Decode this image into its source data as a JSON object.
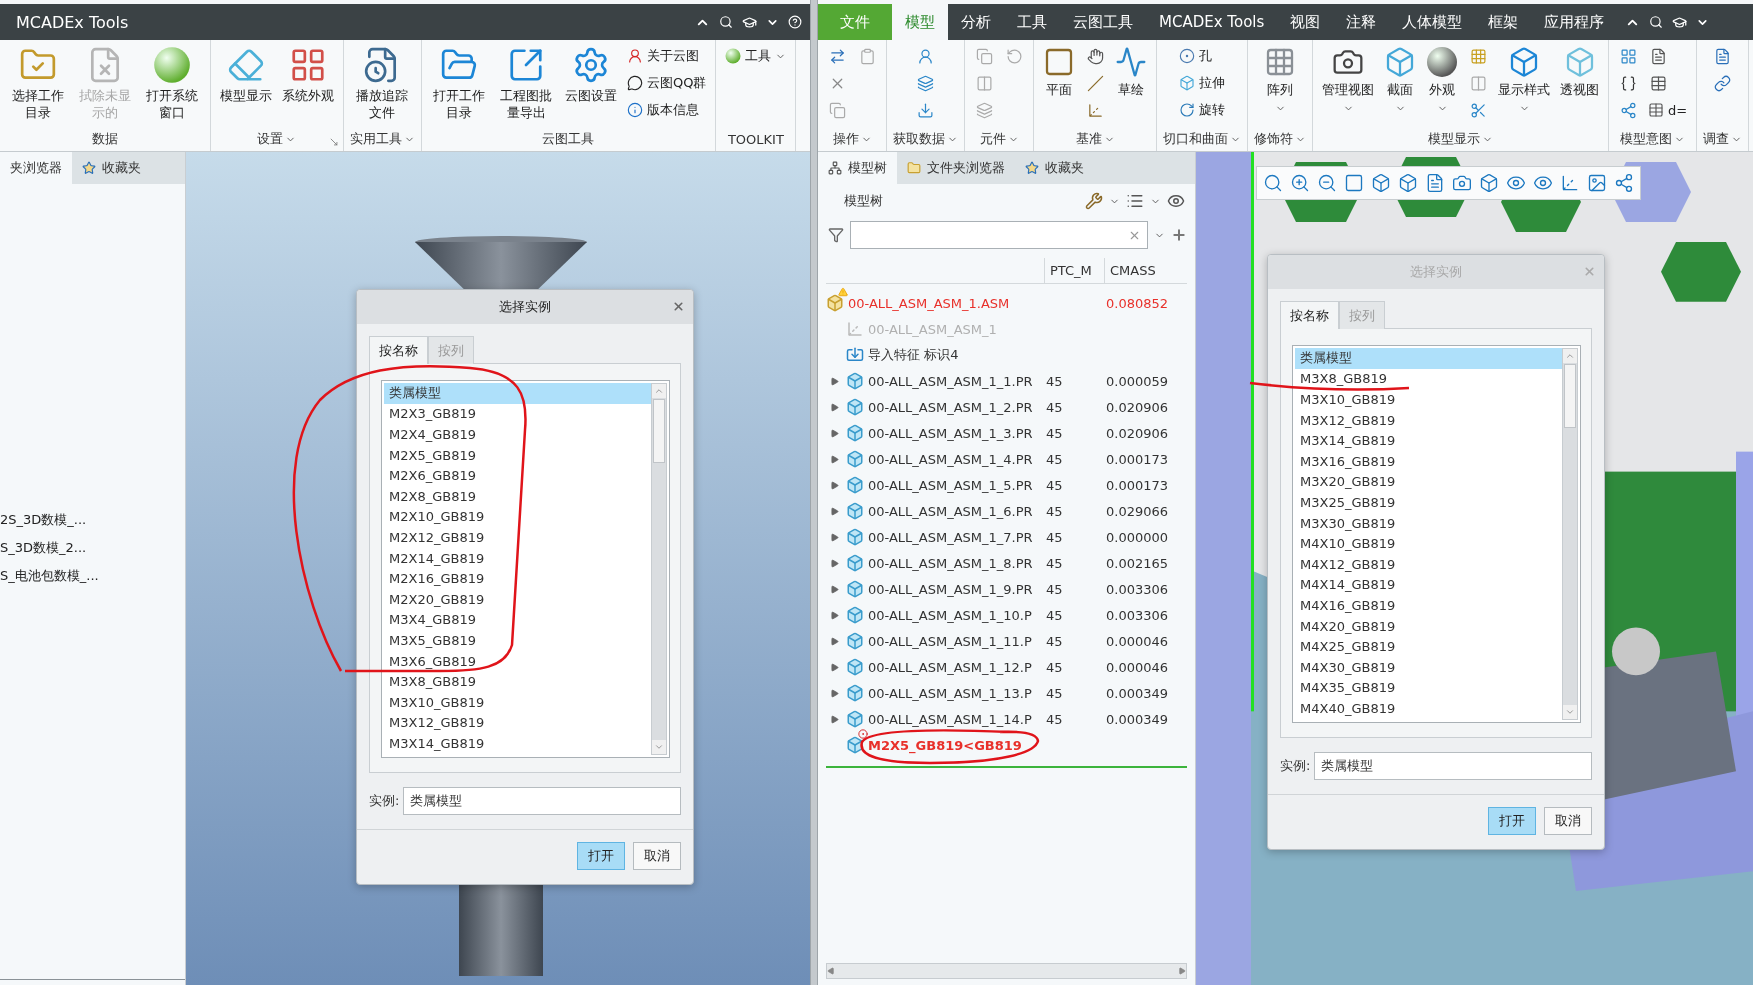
{
  "left_window": {
    "title": "MCADEx Tools",
    "ribbon_groups": [
      {
        "label": "数据",
        "dropdown": false,
        "items": [
          {
            "kind": "large",
            "label": "选择工作目录",
            "disabled": false
          },
          {
            "kind": "large",
            "label": "拭除未显示的",
            "disabled": true
          },
          {
            "kind": "large",
            "label": "打开系统窗口",
            "disabled": false
          }
        ]
      },
      {
        "label": "设置",
        "dropdown": true,
        "launcher": true,
        "items": [
          {
            "kind": "large",
            "label": "模型显示",
            "disabled": false
          },
          {
            "kind": "large",
            "label": "系统外观",
            "disabled": false
          }
        ]
      },
      {
        "label": "实用工具",
        "dropdown": true,
        "items": [
          {
            "kind": "large",
            "label": "播放追踪文件",
            "disabled": false
          }
        ]
      },
      {
        "label": "云图工具",
        "dropdown": false,
        "items": [
          {
            "kind": "large",
            "label": "打开工作目录",
            "disabled": false
          },
          {
            "kind": "large",
            "label": "工程图批量导出",
            "disabled": false
          },
          {
            "kind": "large",
            "label": "云图设置",
            "disabled": false
          },
          {
            "kind": "small",
            "label": "关于云图",
            "disabled": false
          },
          {
            "kind": "small",
            "label": "云图QQ群",
            "disabled": false
          },
          {
            "kind": "small",
            "label": "版本信息",
            "disabled": false
          }
        ]
      },
      {
        "label": "TOOLKIT",
        "dropdown": false,
        "items": [
          {
            "kind": "small",
            "label": "工具",
            "disabled": false,
            "dropdown": true
          }
        ]
      }
    ],
    "side_tabs": [
      {
        "label": "夹浏览器",
        "selected": true
      },
      {
        "label": "收藏夹",
        "selected": false
      }
    ],
    "side_items": [
      "2S_3D数模_...",
      "S_3D数模_2...",
      "S_电池包数模_..."
    ],
    "dialog": {
      "title": "选择实例",
      "active": true,
      "tabs": [
        {
          "label": "按名称",
          "selected": true
        },
        {
          "label": "按列",
          "selected": false
        }
      ],
      "list": [
        {
          "label": "类属模型",
          "selected": true
        },
        {
          "label": "M2X3_GB819",
          "selected": false
        },
        {
          "label": "M2X4_GB819",
          "selected": false
        },
        {
          "label": "M2X5_GB819",
          "selected": false
        },
        {
          "label": "M2X6_GB819",
          "selected": false
        },
        {
          "label": "M2X8_GB819",
          "selected": false
        },
        {
          "label": "M2X10_GB819",
          "selected": false
        },
        {
          "label": "M2X12_GB819",
          "selected": false
        },
        {
          "label": "M2X14_GB819",
          "selected": false
        },
        {
          "label": "M2X16_GB819",
          "selected": false
        },
        {
          "label": "M2X20_GB819",
          "selected": false
        },
        {
          "label": "M3X4_GB819",
          "selected": false
        },
        {
          "label": "M3X5_GB819",
          "selected": false
        },
        {
          "label": "M3X6_GB819",
          "selected": false
        },
        {
          "label": "M3X8_GB819",
          "selected": false
        },
        {
          "label": "M3X10_GB819",
          "selected": false
        },
        {
          "label": "M3X12_GB819",
          "selected": false
        },
        {
          "label": "M3X14_GB819",
          "selected": false
        }
      ],
      "instance_label": "实例:",
      "instance_value": "类属模型",
      "buttons": [
        {
          "label": "打开",
          "primary": true
        },
        {
          "label": "取消",
          "primary": false
        }
      ]
    }
  },
  "right_window": {
    "tabs": [
      {
        "label": "文件",
        "kind": "file",
        "selected": false
      },
      {
        "label": "模型",
        "kind": "tab",
        "selected": true
      },
      {
        "label": "分析",
        "kind": "tab",
        "selected": false
      },
      {
        "label": "工具",
        "kind": "tab",
        "selected": false
      },
      {
        "label": "云图工具",
        "kind": "tab",
        "selected": false
      },
      {
        "label": "MCADEx Tools",
        "kind": "tab",
        "selected": false
      },
      {
        "label": "视图",
        "kind": "tab",
        "selected": false
      },
      {
        "label": "注释",
        "kind": "tab",
        "selected": false
      },
      {
        "label": "人体模型",
        "kind": "tab",
        "selected": false
      },
      {
        "label": "框架",
        "kind": "tab",
        "selected": false
      },
      {
        "label": "应用程序",
        "kind": "tab",
        "selected": false
      }
    ],
    "ribbon_groups": [
      {
        "label": "操作",
        "dropdown": true,
        "items": [
          {
            "kind": "icon"
          },
          {
            "kind": "icon"
          },
          {
            "kind": "icon"
          },
          {
            "kind": "icon"
          }
        ]
      },
      {
        "label": "获取数据",
        "dropdown": true,
        "items": [
          {
            "kind": "icon"
          },
          {
            "kind": "icon"
          },
          {
            "kind": "icon"
          }
        ]
      },
      {
        "label": "元件",
        "dropdown": true,
        "items": [
          {
            "kind": "icon"
          },
          {
            "kind": "icon"
          },
          {
            "kind": "icon"
          },
          {
            "kind": "icon"
          }
        ]
      },
      {
        "label": "基准",
        "dropdown": true,
        "items": [
          {
            "kind": "large",
            "label": "平面",
            "dropdown": false
          },
          {
            "kind": "icon"
          },
          {
            "kind": "icon"
          },
          {
            "kind": "icon"
          },
          {
            "kind": "large",
            "label": "草绘",
            "dropdown": false
          }
        ]
      },
      {
        "label": "切口和曲面",
        "dropdown": true,
        "items": [
          {
            "kind": "small",
            "label": "孔"
          },
          {
            "kind": "small",
            "label": "拉伸"
          },
          {
            "kind": "small",
            "label": "旋转"
          }
        ]
      },
      {
        "label": "修饰符",
        "dropdown": true,
        "items": [
          {
            "kind": "large",
            "label": "阵列",
            "dropdown": true
          }
        ]
      },
      {
        "label": "模型显示",
        "dropdown": true,
        "items": [
          {
            "kind": "large",
            "label": "管理视图",
            "dropdown": true
          },
          {
            "kind": "large",
            "label": "截面",
            "dropdown": true
          },
          {
            "kind": "large",
            "label": "外观",
            "dropdown": true
          },
          {
            "kind": "icon"
          },
          {
            "kind": "icon"
          },
          {
            "kind": "icon"
          },
          {
            "kind": "large",
            "label": "显示样式",
            "dropdown": true
          },
          {
            "kind": "large",
            "label": "透视图",
            "dropdown": false
          }
        ]
      },
      {
        "label": "模型意图",
        "dropdown": true,
        "items": [
          {
            "kind": "icon"
          },
          {
            "kind": "icon"
          },
          {
            "kind": "icon"
          },
          {
            "kind": "icon"
          },
          {
            "kind": "icon"
          },
          {
            "kind": "small",
            "label": "d="
          }
        ]
      },
      {
        "label": "调查",
        "dropdown": true,
        "items": [
          {
            "kind": "icon"
          },
          {
            "kind": "icon"
          }
        ]
      }
    ],
    "model_tree": {
      "tabs": [
        {
          "label": "模型树",
          "selected": true
        },
        {
          "label": "文件夹浏览器",
          "selected": false
        },
        {
          "label": "收藏夹",
          "selected": false
        }
      ],
      "header": "模型树",
      "columns": [
        "PTC_M",
        "CMASS"
      ],
      "root": {
        "name": "00-ALL_ASM_ASM_1.ASM",
        "kind": "assembly",
        "warning": true,
        "mass": "0.080852",
        "children": [
          {
            "name": "00-ALL_ASM_ASM_1",
            "kind": "csys",
            "disabled": true,
            "error": false
          },
          {
            "name": "导入特征 标识4",
            "kind": "import",
            "disabled": false,
            "error": false
          },
          {
            "name": "00-ALL_ASM_ASM_1_1.PR",
            "kind": "part",
            "disabled": false,
            "error": false,
            "expanded": false,
            "material": "45",
            "mass": "0.000059"
          },
          {
            "name": "00-ALL_ASM_ASM_1_2.PR",
            "kind": "part",
            "disabled": false,
            "error": false,
            "expanded": false,
            "material": "45",
            "mass": "0.020906"
          },
          {
            "name": "00-ALL_ASM_ASM_1_3.PR",
            "kind": "part",
            "disabled": false,
            "error": false,
            "expanded": false,
            "material": "45",
            "mass": "0.020906"
          },
          {
            "name": "00-ALL_ASM_ASM_1_4.PR",
            "kind": "part",
            "disabled": false,
            "error": false,
            "expanded": false,
            "material": "45",
            "mass": "0.000173"
          },
          {
            "name": "00-ALL_ASM_ASM_1_5.PR",
            "kind": "part",
            "disabled": false,
            "error": false,
            "expanded": false,
            "material": "45",
            "mass": "0.000173"
          },
          {
            "name": "00-ALL_ASM_ASM_1_6.PR",
            "kind": "part",
            "disabled": false,
            "error": false,
            "expanded": false,
            "material": "45",
            "mass": "0.029066"
          },
          {
            "name": "00-ALL_ASM_ASM_1_7.PR",
            "kind": "part",
            "disabled": false,
            "error": false,
            "expanded": false,
            "material": "45",
            "mass": "0.000000"
          },
          {
            "name": "00-ALL_ASM_ASM_1_8.PR",
            "kind": "part",
            "disabled": false,
            "error": false,
            "expanded": false,
            "material": "45",
            "mass": "0.002165"
          },
          {
            "name": "00-ALL_ASM_ASM_1_9.PR",
            "kind": "part",
            "disabled": false,
            "error": false,
            "expanded": false,
            "material": "45",
            "mass": "0.003306"
          },
          {
            "name": "00-ALL_ASM_ASM_1_10.P",
            "kind": "part",
            "disabled": false,
            "error": false,
            "expanded": false,
            "material": "45",
            "mass": "0.003306"
          },
          {
            "name": "00-ALL_ASM_ASM_1_11.P",
            "kind": "part",
            "disabled": false,
            "error": false,
            "expanded": false,
            "material": "45",
            "mass": "0.000046"
          },
          {
            "name": "00-ALL_ASM_ASM_1_12.P",
            "kind": "part",
            "disabled": false,
            "error": false,
            "expanded": false,
            "material": "45",
            "mass": "0.000046"
          },
          {
            "name": "00-ALL_ASM_ASM_1_13.P",
            "kind": "part",
            "disabled": false,
            "error": false,
            "expanded": false,
            "material": "45",
            "mass": "0.000349"
          },
          {
            "name": "00-ALL_ASM_ASM_1_14.P",
            "kind": "part",
            "disabled": false,
            "error": false,
            "expanded": false,
            "material": "45",
            "mass": "0.000349"
          },
          {
            "name": "M2X5_GB819<GB819",
            "kind": "part",
            "disabled": false,
            "error": true
          }
        ]
      }
    },
    "dialog": {
      "title": "选择实例",
      "active": false,
      "tabs": [
        {
          "label": "按名称",
          "selected": true
        },
        {
          "label": "按列",
          "selected": false
        }
      ],
      "list": [
        {
          "label": "类属模型",
          "selected": true
        },
        {
          "label": "M3X8_GB819",
          "selected": false
        },
        {
          "label": "M3X10_GB819",
          "selected": false
        },
        {
          "label": "M3X12_GB819",
          "selected": false
        },
        {
          "label": "M3X14_GB819",
          "selected": false
        },
        {
          "label": "M3X16_GB819",
          "selected": false
        },
        {
          "label": "M3X20_GB819",
          "selected": false
        },
        {
          "label": "M3X25_GB819",
          "selected": false
        },
        {
          "label": "M3X30_GB819",
          "selected": false
        },
        {
          "label": "M4X10_GB819",
          "selected": false
        },
        {
          "label": "M4X12_GB819",
          "selected": false
        },
        {
          "label": "M4X14_GB819",
          "selected": false
        },
        {
          "label": "M4X16_GB819",
          "selected": false
        },
        {
          "label": "M4X20_GB819",
          "selected": false
        },
        {
          "label": "M4X25_GB819",
          "selected": false
        },
        {
          "label": "M4X30_GB819",
          "selected": false
        },
        {
          "label": "M4X35_GB819",
          "selected": false
        },
        {
          "label": "M4X40_GB819",
          "selected": false
        }
      ],
      "instance_label": "实例:",
      "instance_value": "类属模型",
      "buttons": [
        {
          "label": "打开",
          "primary": true
        },
        {
          "label": "取消",
          "primary": false
        }
      ]
    }
  }
}
